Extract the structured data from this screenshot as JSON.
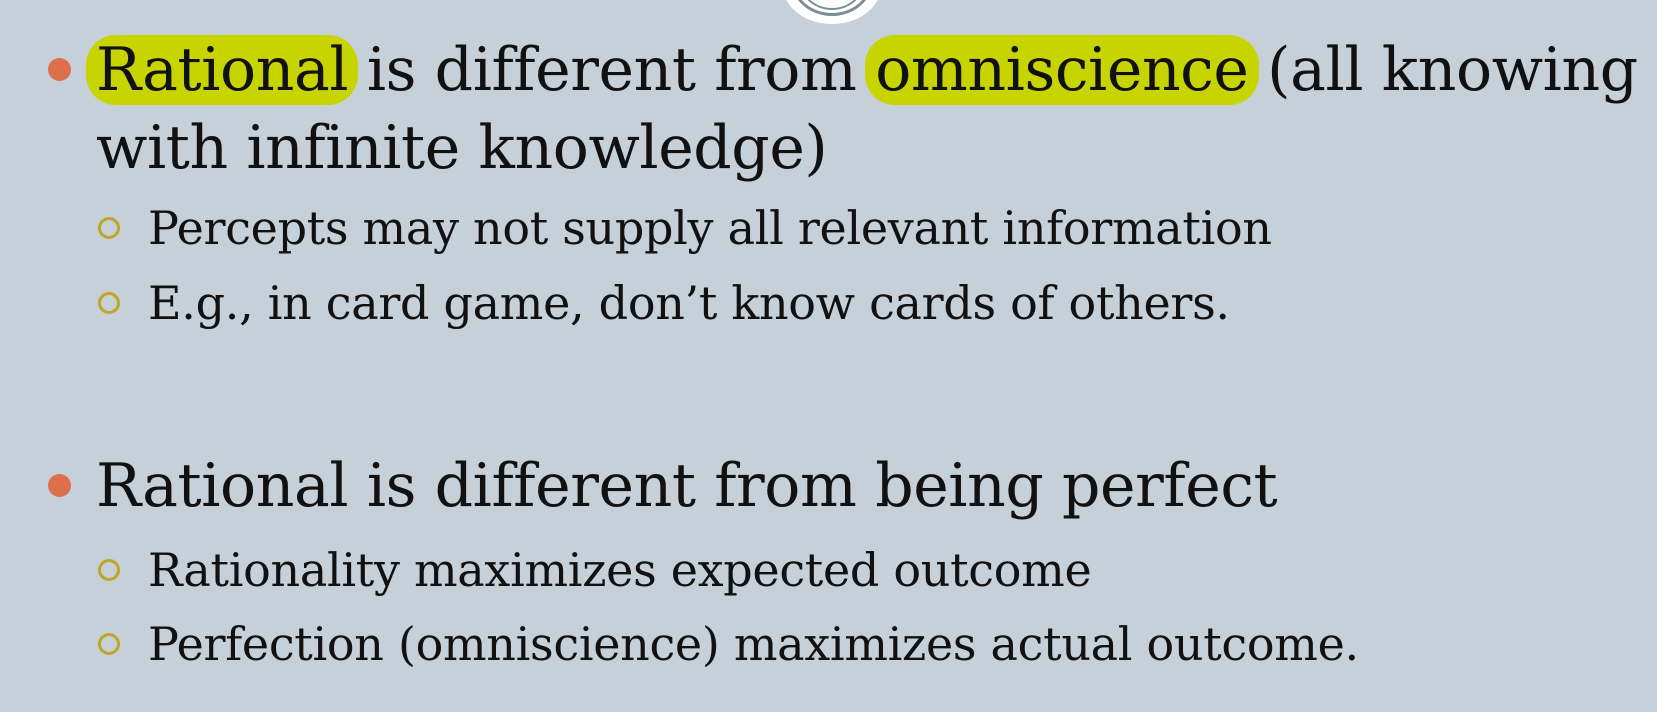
{
  "colors": {
    "background": "#c5d0d8",
    "bullet_primary": "#de6f4e",
    "bullet_secondary": "#c1a52a",
    "highlight": "#c8d400"
  },
  "icons": {
    "primary_bullet": "filled-circle",
    "secondary_bullet": "hollow-circle",
    "ornament": "circle-ring-ornament"
  },
  "bullets": [
    {
      "line1_parts": [
        "Rational",
        " is different from ",
        "omniscience",
        " (all knowing"
      ],
      "line2": "with infinite knowledge)",
      "highlighted_terms": [
        "Rational",
        "omniscience"
      ],
      "sub_items": [
        "Percepts may not supply all relevant information",
        "E.g., in card game, don’t know cards of others."
      ]
    },
    {
      "text": "Rational is different from being perfect",
      "sub_items": [
        "Rationality maximizes expected outcome",
        "Perfection (omniscience) maximizes actual outcome."
      ]
    }
  ]
}
